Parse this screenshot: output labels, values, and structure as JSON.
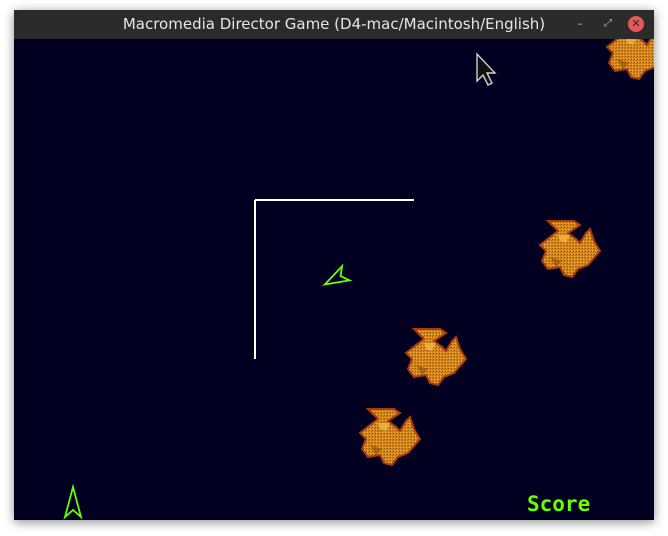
{
  "window": {
    "title": "Macromedia Director Game (D4-mac/Macintosh/English)",
    "controls": {
      "minimize_icon": "minimize-icon",
      "maximize_icon": "maximize-icon",
      "close_icon": "close-icon"
    }
  },
  "game": {
    "score_label": "Score",
    "lives_remaining": 1,
    "asteroid_count": 4,
    "colors": {
      "background": "#010020",
      "ship": "#66ff00",
      "asteroid_fill": "#d88a18",
      "asteroid_edge": "#a04010",
      "asteroid_shade": "#8a4a10",
      "frame_line": "#ffffff",
      "score_text": "#66ff00"
    }
  }
}
